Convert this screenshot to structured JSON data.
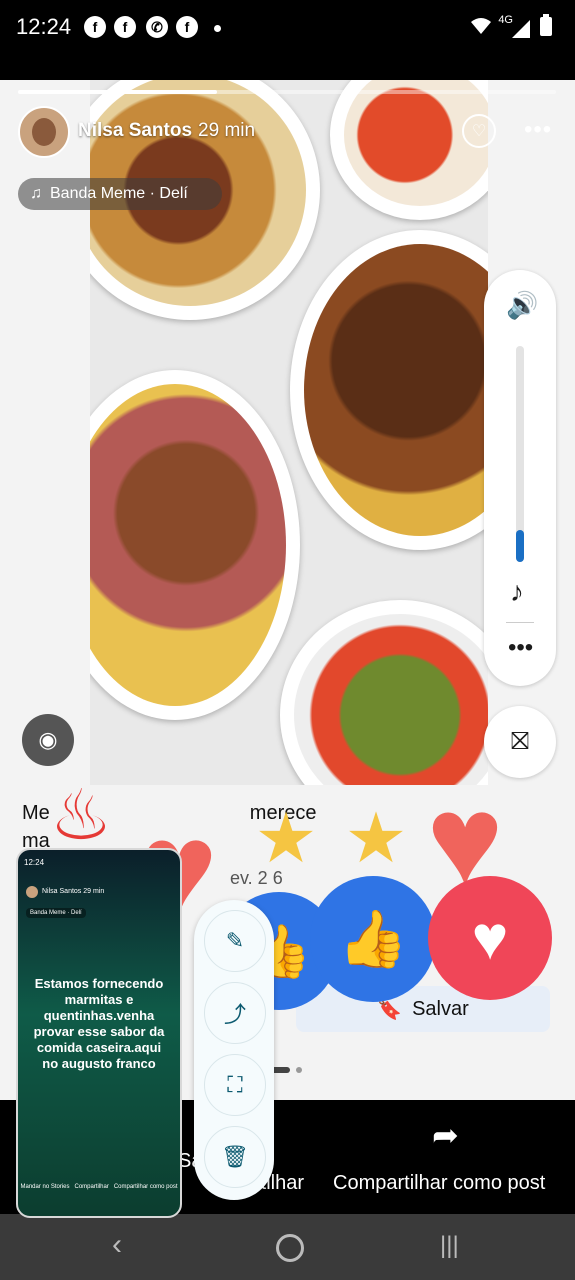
{
  "status_bar": {
    "time": "12:24",
    "network": "4G",
    "notification_icons": [
      "facebook-icon",
      "facebook-icon",
      "whatsapp-icon",
      "facebook-icon"
    ]
  },
  "story": {
    "author": "Nilsa Santos",
    "time_ago": "29 min",
    "music": "Banda Meme · Delí",
    "progress": 0.37
  },
  "post": {
    "line1": "Me",
    "line1b": "merece",
    "line2": "ma",
    "meta": "ev. 2 6",
    "save_label": "Salvar"
  },
  "bottom_bar": {
    "save_label": "Sa",
    "share_label": "rtilhar",
    "share_post_label": "Compartilhar como post"
  },
  "thumbnail": {
    "status": "12:24",
    "author": "Nilsa Santos 29 min",
    "chip": "Banda Meme · Delí",
    "message": "Estamos fornecendo marmitas e quentinhas.venha provar esse sabor da comida caseira.aqui no augusto franco",
    "actions": [
      "Mandar no Stories",
      "Compartilhar",
      "Compartilhar como post"
    ]
  },
  "tools": [
    "pencil-icon",
    "share-icon",
    "screenshot-scan-icon",
    "trash-icon"
  ],
  "colors": {
    "like_blue": "#2f74e5",
    "love_red": "#f04658",
    "accent_blue": "#1a6fc4"
  }
}
